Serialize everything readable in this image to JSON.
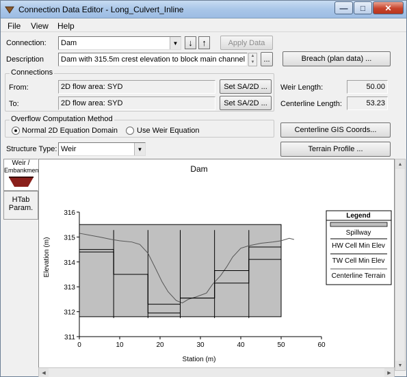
{
  "window": {
    "title": "Connection Data Editor - Long_Culvert_Inline",
    "minimize_glyph": "—",
    "maximize_glyph": "□",
    "close_glyph": "✕"
  },
  "menu": {
    "file": "File",
    "view": "View",
    "help": "Help"
  },
  "form": {
    "connection_label": "Connection:",
    "connection_value": "Dam",
    "apply_data": "Apply Data",
    "description_label": "Description",
    "description_value": "Dam with 315.5m crest elevation to block main channel",
    "ellipsis_button": "...",
    "breach_button": "Breach (plan data) ..."
  },
  "connections": {
    "title": "Connections",
    "from_label": "From:",
    "from_value": "2D flow area: SYD",
    "to_label": "To:",
    "to_value": "2D flow area: SYD",
    "set_button": "Set SA/2D ..."
  },
  "lengths": {
    "weir_label": "Weir Length:",
    "weir_value": "50.00",
    "centerline_label": "Centerline Length:",
    "centerline_value": "53.23"
  },
  "overflow": {
    "title": "Overflow Computation Method",
    "option1": "Normal 2D Equation Domain",
    "option2": "Use Weir Equation",
    "selected": "Normal 2D Equation Domain"
  },
  "buttons": {
    "gis_coords": "Centerline GIS Coords...",
    "terrain_profile": "Terrain Profile ..."
  },
  "structure": {
    "label": "Structure Type:",
    "value": "Weir"
  },
  "tabs": {
    "weir_line1": "Weir /",
    "weir_line2": "Embankment",
    "htab_line1": "HTab",
    "htab_line2": "Param."
  },
  "chart_data": {
    "type": "line",
    "title": "Dam",
    "xlabel": "Station (m)",
    "ylabel": "Elevation (m)",
    "xlim": [
      0,
      60
    ],
    "ylim": [
      311,
      316
    ],
    "x_ticks": [
      "0",
      "10",
      "20",
      "30",
      "40",
      "50",
      "60"
    ],
    "y_ticks": [
      "311",
      "312",
      "313",
      "314",
      "315",
      "316"
    ],
    "spillway": {
      "x0": 0,
      "x1": 50,
      "y0": 311.8,
      "y1": 315.5
    },
    "centerline_terrain": [
      [
        0,
        315.15
      ],
      [
        5,
        315.0
      ],
      [
        8,
        314.9
      ],
      [
        10,
        314.85
      ],
      [
        13,
        314.8
      ],
      [
        15,
        314.7
      ],
      [
        17,
        314.35
      ],
      [
        19,
        313.7
      ],
      [
        20.5,
        313.2
      ],
      [
        22,
        312.8
      ],
      [
        24,
        312.45
      ],
      [
        25.5,
        312.35
      ],
      [
        27,
        312.5
      ],
      [
        29,
        312.6
      ],
      [
        31.5,
        312.75
      ],
      [
        33,
        313.1
      ],
      [
        35,
        313.45
      ],
      [
        36.5,
        313.8
      ],
      [
        38,
        314.2
      ],
      [
        40,
        314.55
      ],
      [
        42,
        314.65
      ],
      [
        45,
        314.75
      ],
      [
        48,
        314.8
      ],
      [
        50,
        314.85
      ],
      [
        52,
        314.95
      ],
      [
        53.2,
        314.9
      ]
    ],
    "hw_cell_min_elev": [
      [
        0,
        314.5
      ],
      [
        8.5,
        314.5
      ],
      [
        8.5,
        313.5
      ],
      [
        17,
        313.5
      ],
      [
        17,
        312.3
      ],
      [
        25,
        312.3
      ],
      [
        25,
        312.55
      ],
      [
        33.5,
        312.55
      ],
      [
        33.5,
        313.65
      ],
      [
        42,
        313.65
      ],
      [
        42,
        314.6
      ],
      [
        50,
        314.6
      ]
    ],
    "tw_cell_min_elev": [
      [
        0,
        314.4
      ],
      [
        8.5,
        314.4
      ],
      [
        8.5,
        313.5
      ],
      [
        17,
        313.5
      ],
      [
        17,
        311.95
      ],
      [
        25,
        311.95
      ],
      [
        25,
        312.55
      ],
      [
        33.5,
        312.55
      ],
      [
        33.5,
        313.15
      ],
      [
        42,
        313.15
      ],
      [
        42,
        314.1
      ],
      [
        50,
        314.1
      ]
    ],
    "cell_dividers": [
      8.5,
      17,
      25,
      33.5,
      42
    ],
    "legend": {
      "title": "Legend",
      "entries": [
        "Spillway",
        "HW Cell Min Elev",
        "TW Cell Min Elev",
        "Centerline Terrain"
      ]
    }
  }
}
